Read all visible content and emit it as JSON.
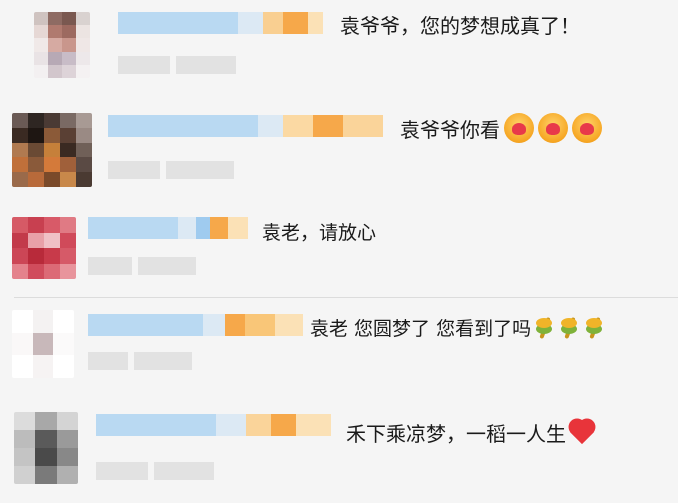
{
  "comments": [
    {
      "text": "袁爷爷，您的梦想成真了！",
      "emoji": []
    },
    {
      "text": "袁爷爷你看",
      "emoji": [
        "face-with-hearts-emoji",
        "face-with-hearts-emoji",
        "face-with-hearts-emoji"
      ]
    },
    {
      "text": "袁老，请放心",
      "emoji": []
    },
    {
      "text": "袁老 您圆梦了 您看到了吗",
      "emoji": [
        "rice-ear-emoji",
        "rice-ear-emoji",
        "rice-ear-emoji"
      ]
    },
    {
      "text": "禾下乘凉梦，一稻一人生",
      "emoji": [
        "red-heart-emoji"
      ]
    }
  ],
  "colors": {
    "username_blue": "#b9d9f2",
    "vip_orange": "#f7b24a",
    "meta_gray": "#e2e2e2",
    "background": "#f5f5f5"
  }
}
